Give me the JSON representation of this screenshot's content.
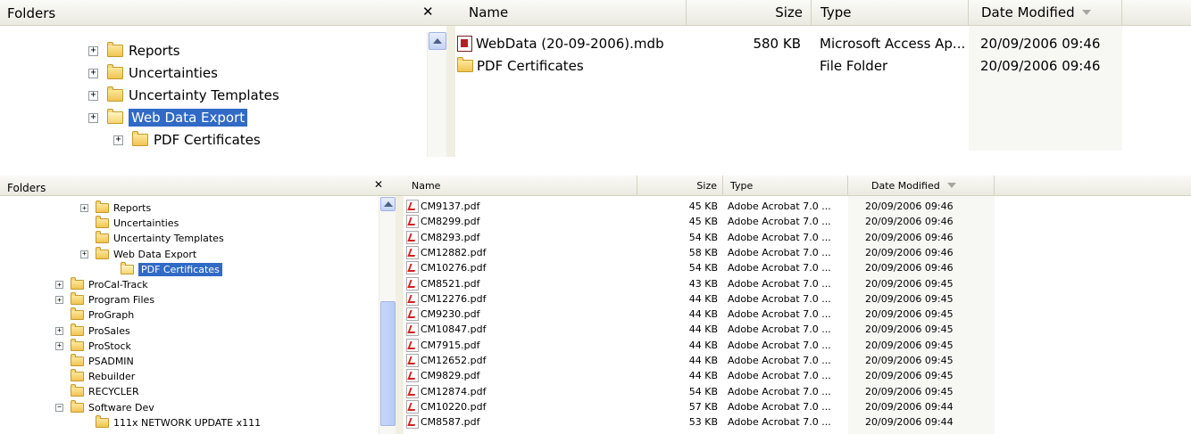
{
  "top": {
    "folders_title": "Folders",
    "close": "✕",
    "columns": {
      "name": "Name",
      "size": "Size",
      "type": "Type",
      "date": "Date Modified"
    },
    "tree": [
      {
        "label": "Reports",
        "expander": "+"
      },
      {
        "label": "Uncertainties",
        "expander": "+"
      },
      {
        "label": "Uncertainty Templates",
        "expander": "+"
      },
      {
        "label": "Web Data Export",
        "expander": "+",
        "selected": true
      },
      {
        "label": "PDF Certificates",
        "expander": "+"
      }
    ],
    "files": [
      {
        "name": "WebData (20-09-2006).mdb",
        "icon": "access-db-icon",
        "size": "580 KB",
        "type": "Microsoft Access Ap...",
        "date": "20/09/2006 09:46"
      },
      {
        "name": "PDF Certificates",
        "icon": "folder-icon",
        "size": "",
        "type": "File Folder",
        "date": "20/09/2006 09:46"
      }
    ]
  },
  "bottom": {
    "folders_title": "Folders",
    "close": "✕",
    "columns": {
      "name": "Name",
      "size": "Size",
      "type": "Type",
      "date": "Date Modified"
    },
    "tree": [
      {
        "label": "Reports",
        "expander": "+",
        "level": 1
      },
      {
        "label": "Uncertainties",
        "expander": "",
        "level": 1
      },
      {
        "label": "Uncertainty Templates",
        "expander": "",
        "level": 1
      },
      {
        "label": "Web Data Export",
        "expander": "+",
        "level": 1
      },
      {
        "label": "PDF Certificates",
        "expander": "",
        "level": 2,
        "selected": true
      },
      {
        "label": "ProCal-Track",
        "expander": "+",
        "level": 0
      },
      {
        "label": "Program Files",
        "expander": "+",
        "level": 0
      },
      {
        "label": "ProGraph",
        "expander": "",
        "level": 0
      },
      {
        "label": "ProSales",
        "expander": "+",
        "level": 0
      },
      {
        "label": "ProStock",
        "expander": "+",
        "level": 0
      },
      {
        "label": "PSADMIN",
        "expander": "",
        "level": 0
      },
      {
        "label": "Rebuilder",
        "expander": "",
        "level": 0
      },
      {
        "label": "RECYCLER",
        "expander": "",
        "level": 0
      },
      {
        "label": "Software Dev",
        "expander": "−",
        "level": 0
      },
      {
        "label": "111x NETWORK UPDATE x111",
        "expander": "",
        "level": 1
      }
    ],
    "files": [
      {
        "name": "CM9137.pdf",
        "size": "45 KB",
        "type": "Adobe Acrobat 7.0 ...",
        "date": "20/09/2006 09:46"
      },
      {
        "name": "CM8299.pdf",
        "size": "45 KB",
        "type": "Adobe Acrobat 7.0 ...",
        "date": "20/09/2006 09:46"
      },
      {
        "name": "CM8293.pdf",
        "size": "54 KB",
        "type": "Adobe Acrobat 7.0 ...",
        "date": "20/09/2006 09:46"
      },
      {
        "name": "CM12882.pdf",
        "size": "58 KB",
        "type": "Adobe Acrobat 7.0 ...",
        "date": "20/09/2006 09:46"
      },
      {
        "name": "CM10276.pdf",
        "size": "54 KB",
        "type": "Adobe Acrobat 7.0 ...",
        "date": "20/09/2006 09:46"
      },
      {
        "name": "CM8521.pdf",
        "size": "43 KB",
        "type": "Adobe Acrobat 7.0 ...",
        "date": "20/09/2006 09:45"
      },
      {
        "name": "CM12276.pdf",
        "size": "44 KB",
        "type": "Adobe Acrobat 7.0 ...",
        "date": "20/09/2006 09:45"
      },
      {
        "name": "CM9230.pdf",
        "size": "44 KB",
        "type": "Adobe Acrobat 7.0 ...",
        "date": "20/09/2006 09:45"
      },
      {
        "name": "CM10847.pdf",
        "size": "44 KB",
        "type": "Adobe Acrobat 7.0 ...",
        "date": "20/09/2006 09:45"
      },
      {
        "name": "CM7915.pdf",
        "size": "44 KB",
        "type": "Adobe Acrobat 7.0 ...",
        "date": "20/09/2006 09:45"
      },
      {
        "name": "CM12652.pdf",
        "size": "44 KB",
        "type": "Adobe Acrobat 7.0 ...",
        "date": "20/09/2006 09:45"
      },
      {
        "name": "CM9829.pdf",
        "size": "44 KB",
        "type": "Adobe Acrobat 7.0 ...",
        "date": "20/09/2006 09:45"
      },
      {
        "name": "CM12874.pdf",
        "size": "54 KB",
        "type": "Adobe Acrobat 7.0 ...",
        "date": "20/09/2006 09:45"
      },
      {
        "name": "CM10220.pdf",
        "size": "57 KB",
        "type": "Adobe Acrobat 7.0 ...",
        "date": "20/09/2006 09:44"
      },
      {
        "name": "CM8587.pdf",
        "size": "53 KB",
        "type": "Adobe Acrobat 7.0 ...",
        "date": "20/09/2006 09:44"
      }
    ]
  }
}
